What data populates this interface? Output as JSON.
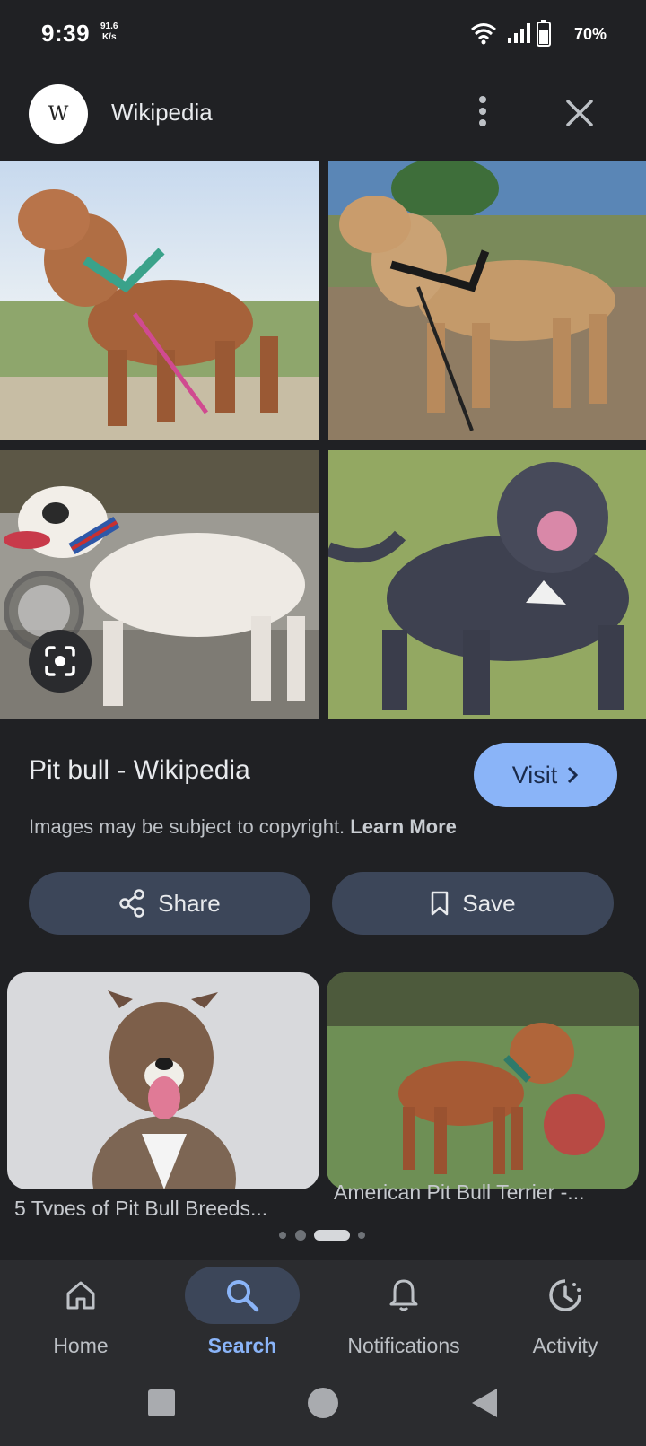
{
  "status": {
    "time": "9:39",
    "net_speed_value": "91.6",
    "net_speed_unit": "K/s",
    "battery": "70%"
  },
  "header": {
    "logo_letter": "W",
    "title": "Wikipedia"
  },
  "result": {
    "title": "Pit bull - Wikipedia",
    "visit_label": "Visit",
    "copyright_text": "Images may be subject to copyright.",
    "learn_more": "Learn More",
    "share_label": "Share",
    "save_label": "Save"
  },
  "related": [
    {
      "caption": "5 Types of Pit Bull Breeds..."
    },
    {
      "caption": "American Pit Bull Terrier -..."
    }
  ],
  "nav": {
    "items": [
      {
        "label": "Home",
        "icon": "home-icon"
      },
      {
        "label": "Search",
        "icon": "search-icon",
        "active": true
      },
      {
        "label": "Notifications",
        "icon": "bell-icon"
      },
      {
        "label": "Activity",
        "icon": "activity-icon"
      }
    ]
  },
  "colors": {
    "background": "#202124",
    "accent": "#8ab4f8",
    "button": "#3c4659"
  }
}
